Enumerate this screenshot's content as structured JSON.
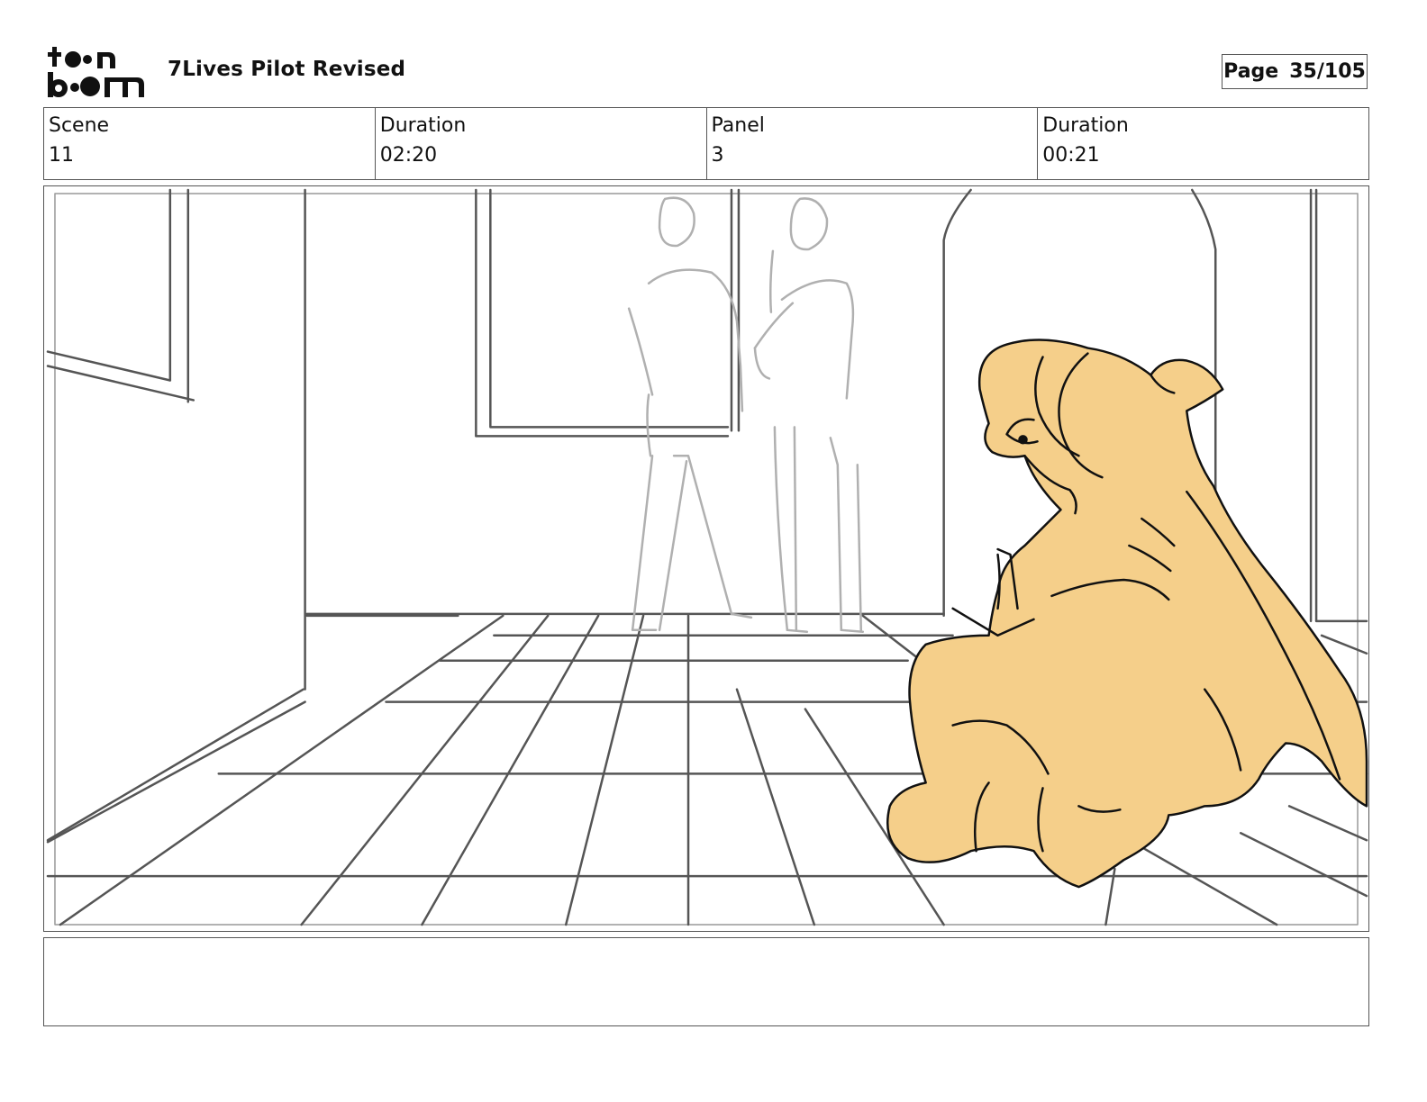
{
  "header": {
    "logo_alt": "toon boom",
    "title": "7Lives Pilot Revised",
    "page_label": "Page",
    "page_number": "35/105"
  },
  "info": {
    "scene_label": "Scene",
    "scene_value": "11",
    "scene_duration_label": "Duration",
    "scene_duration_value": "02:20",
    "panel_label": "Panel",
    "panel_value": "3",
    "panel_duration_label": "Duration",
    "panel_duration_value": "00:21"
  },
  "notes": {
    "text": ""
  },
  "colors": {
    "sketch_line": "#555555",
    "sketch_light": "#b0b0b0",
    "character_fill": "#f5cf8a"
  }
}
